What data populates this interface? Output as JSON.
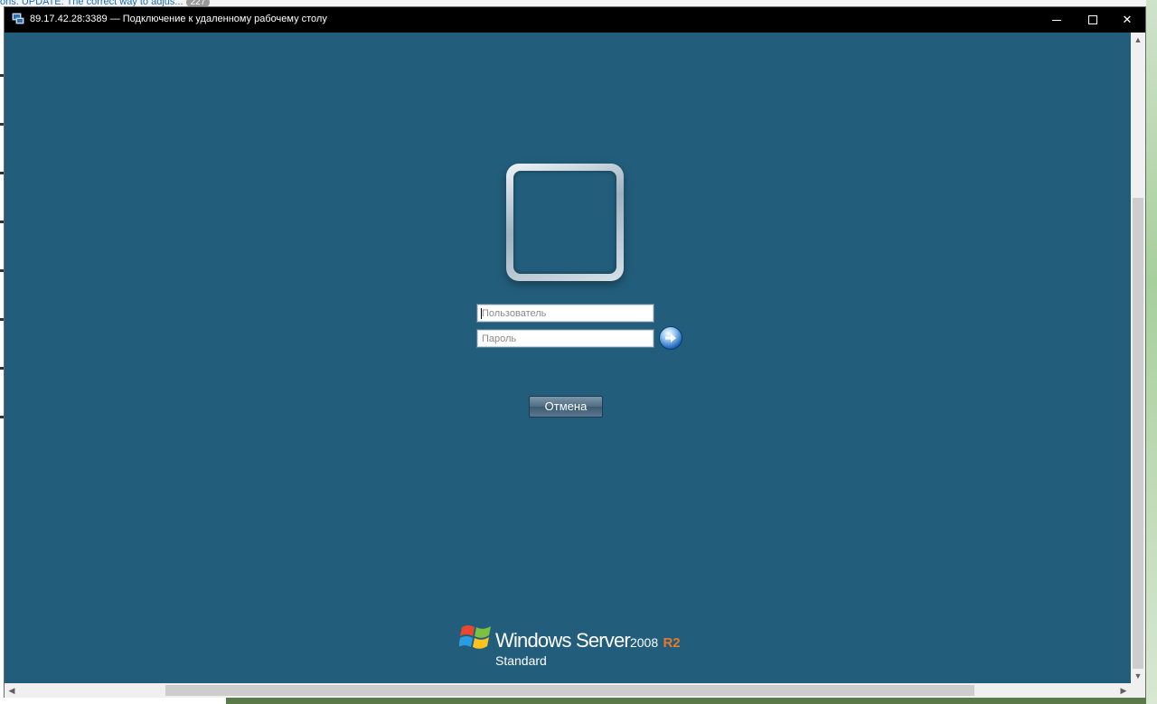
{
  "background": {
    "top_snippet": "ons. UPDATE: The correct way to adjus...",
    "top_badge": "227"
  },
  "window": {
    "title": "89.17.42.28:3389 — Подключение к удаленному рабочему столу",
    "minimize_glyph": "—",
    "maximize_glyph": "☐",
    "close_glyph": "✕"
  },
  "login": {
    "username_placeholder": "Пользователь",
    "password_placeholder": "Пароль",
    "cancel_label": "Отмена"
  },
  "branding": {
    "product": "Windows Server",
    "version": "2008",
    "release": "R2",
    "edition": "Standard"
  },
  "scrollbars": {
    "up": "▲",
    "down": "▼",
    "left": "◀",
    "right": "▶"
  },
  "colors": {
    "desktop_bg": "#225e7c",
    "titlebar": "#000000",
    "r2_accent": "#e27b2a"
  }
}
